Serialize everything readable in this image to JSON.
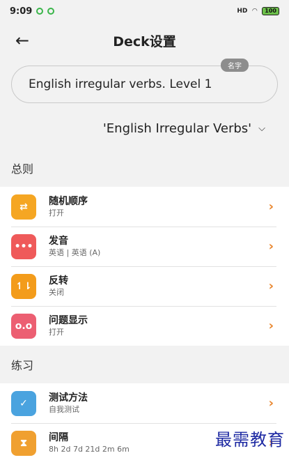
{
  "status": {
    "time": "9:09",
    "battery": "100",
    "signal": "HD"
  },
  "header": {
    "title": "Deck设置"
  },
  "name_field": {
    "tag": "名字",
    "value": "English irregular verbs. Level 1"
  },
  "deck_select": {
    "value": "'English Irregular Verbs'"
  },
  "sections": {
    "general": "总则",
    "practice": "练习"
  },
  "general_items": [
    {
      "label": "随机顺序",
      "sub": "打开"
    },
    {
      "label": "发音",
      "sub": "英语 | 英语 (A)"
    },
    {
      "label": "反转",
      "sub": "关闭"
    },
    {
      "label": "问题显示",
      "sub": "打开"
    }
  ],
  "practice_items": [
    {
      "label": "测试方法",
      "sub": "自我测试"
    },
    {
      "label": "间隔",
      "sub": "8h  2d  7d  21d  2m  6m"
    }
  ],
  "watermark": "最需教育",
  "colors": {
    "accent": "#e8842a",
    "background": "#f2f2f2"
  }
}
